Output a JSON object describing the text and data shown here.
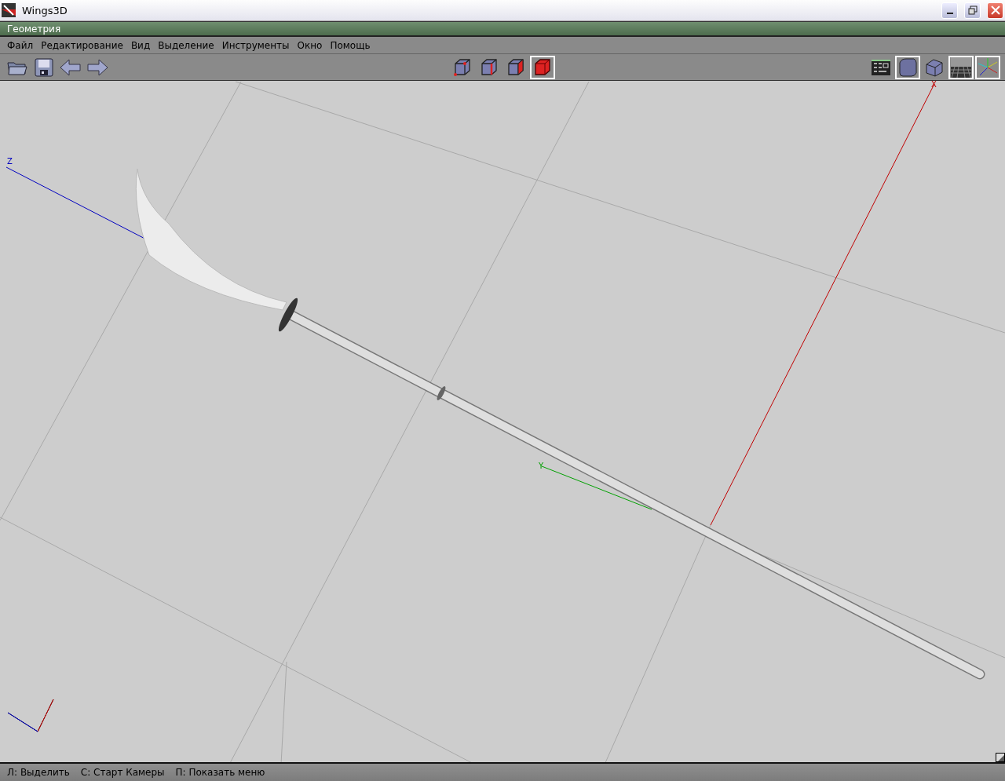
{
  "window": {
    "title": "Wings3D"
  },
  "geometry_bar": {
    "title": "Геометрия"
  },
  "menu": [
    "Файл",
    "Редактирование",
    "Вид",
    "Выделение",
    "Инструменты",
    "Окно",
    "Помощь"
  ],
  "toolbar": {
    "file_buttons": [
      {
        "kind": "open"
      },
      {
        "kind": "save"
      },
      {
        "kind": "undo"
      },
      {
        "kind": "redo"
      }
    ],
    "selection_modes": [
      {
        "kind": "vertex",
        "selected": false
      },
      {
        "kind": "edge",
        "selected": false
      },
      {
        "kind": "face",
        "selected": false
      },
      {
        "kind": "body",
        "selected": true
      }
    ],
    "view_buttons": [
      {
        "kind": "outliner",
        "selected": false
      },
      {
        "kind": "smooth",
        "selected": true
      },
      {
        "kind": "wireframe",
        "selected": false
      },
      {
        "kind": "groundplane",
        "selected": true
      },
      {
        "kind": "axes",
        "selected": true
      }
    ]
  },
  "viewport": {
    "axes": [
      {
        "kind": "x",
        "label": "X"
      },
      {
        "kind": "y",
        "label": "Y"
      },
      {
        "kind": "z",
        "label": "Z"
      }
    ]
  },
  "status_bar": [
    "Л: Выделить",
    "С: Старт Камеры",
    "П: Показать меню"
  ]
}
